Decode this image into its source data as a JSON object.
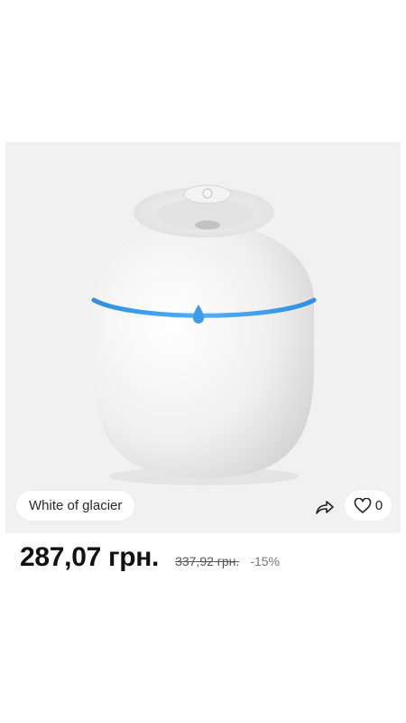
{
  "product": {
    "variant_label": "White of glacier",
    "likes_count": "0",
    "price_current": "287,07 грн.",
    "price_old": "337,92 грн.",
    "discount": "-15%"
  },
  "colors": {
    "gallery_bg": "#f1f1f1",
    "led_ring": "#3d9be9",
    "text_primary": "#111111"
  },
  "icons": {
    "share": "share-icon",
    "like": "heart-icon",
    "water_drop": "water-drop-icon"
  }
}
